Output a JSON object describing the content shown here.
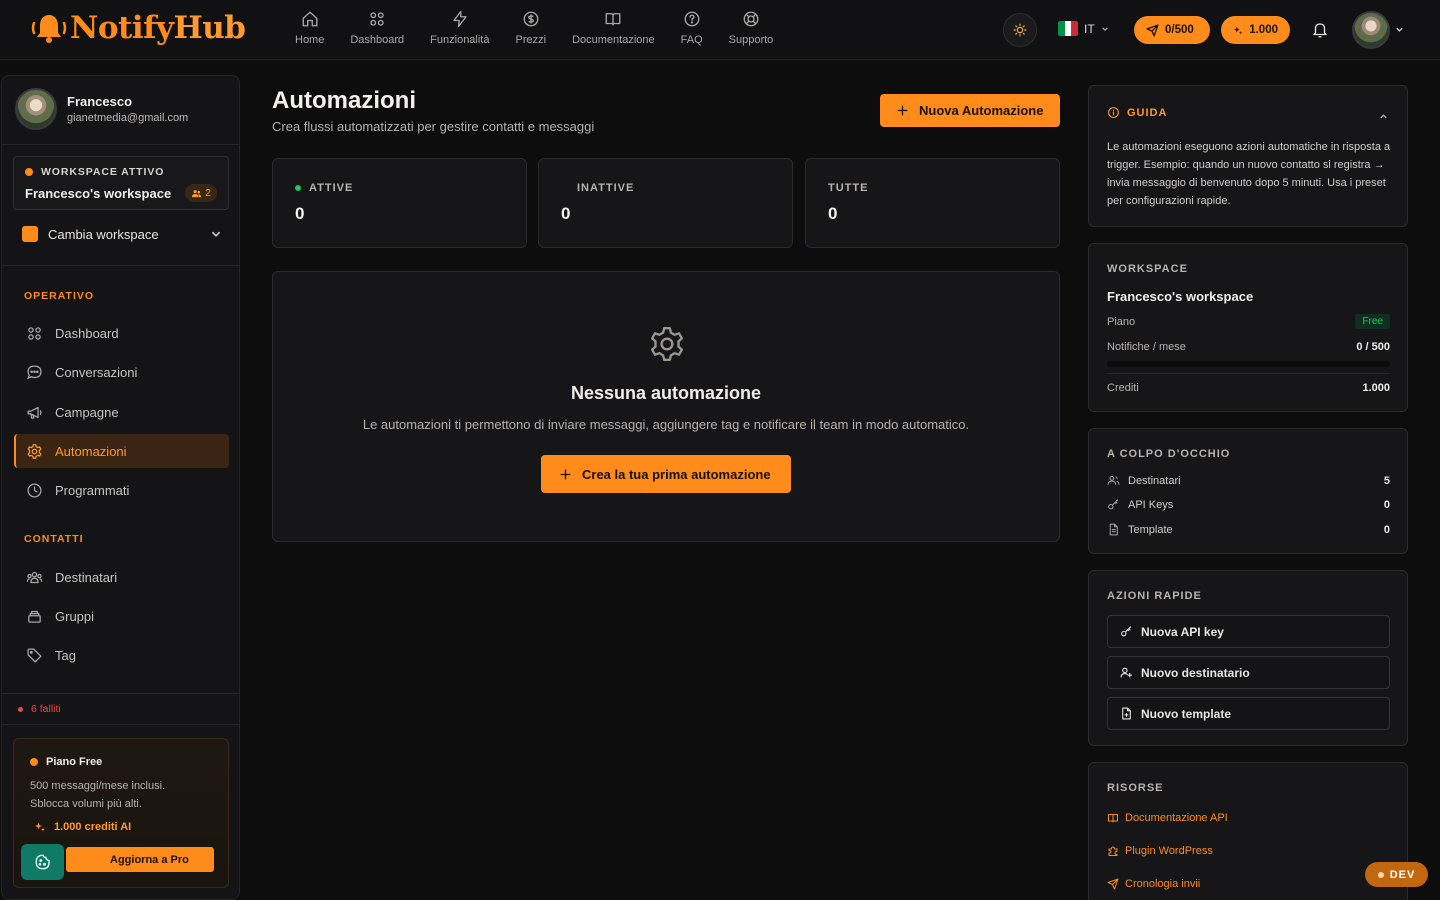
{
  "brand": {
    "name_left": "Notify",
    "name_right": "Hub"
  },
  "nav": [
    {
      "label": "Home",
      "icon": "home-icon"
    },
    {
      "label": "Dashboard",
      "icon": "grid-icon"
    },
    {
      "label": "Funzionalità",
      "icon": "bolt-icon"
    },
    {
      "label": "Prezzi",
      "icon": "dollar-icon"
    },
    {
      "label": "Documentazione",
      "icon": "book-icon"
    },
    {
      "label": "FAQ",
      "icon": "help-circle-icon"
    },
    {
      "label": "Supporto",
      "icon": "lifebuoy-icon"
    }
  ],
  "header": {
    "language": "IT",
    "quota": "0/500",
    "credits": "1.000"
  },
  "user": {
    "name": "Francesco",
    "email": "gianetmedia@gmail.com"
  },
  "workspace": {
    "active_label": "WORKSPACE ATTIVO",
    "name": "Francesco's workspace",
    "members": "2",
    "switch_label": "Cambia workspace"
  },
  "sidebar": {
    "section_operativo": "OPERATIVO",
    "operativo": [
      {
        "label": "Dashboard",
        "icon": "grid-icon"
      },
      {
        "label": "Conversazioni",
        "icon": "chat-icon"
      },
      {
        "label": "Campagne",
        "icon": "megaphone-icon"
      },
      {
        "label": "Automazioni",
        "icon": "gear-icon"
      },
      {
        "label": "Programmati",
        "icon": "clock-icon"
      }
    ],
    "section_contatti": "CONTATTI",
    "contatti": [
      {
        "label": "Destinatari",
        "icon": "users-icon"
      },
      {
        "label": "Gruppi",
        "icon": "stack-icon"
      },
      {
        "label": "Tag",
        "icon": "tag-icon"
      }
    ],
    "failed": "6 falliti"
  },
  "plan": {
    "title": "Piano Free",
    "desc_line1": "500 messaggi/mese inclusi.",
    "desc_line2": "Sblocca volumi più alti.",
    "credits": "1.000 crediti AI",
    "upgrade": "Aggiorna a Pro"
  },
  "main": {
    "title": "Automazioni",
    "subtitle": "Crea flussi automatizzati per gestire contatti e messaggi",
    "new_button": "Nuova Automazione",
    "stats": [
      {
        "label": "ATTIVE",
        "value": "0"
      },
      {
        "label": "INATTIVE",
        "value": "0"
      },
      {
        "label": "TUTTE",
        "value": "0"
      }
    ],
    "empty": {
      "title": "Nessuna automazione",
      "desc": "Le automazioni ti permettono di inviare messaggi, aggiungere tag e notificare il team in modo automatico.",
      "button": "Crea la tua prima automazione"
    }
  },
  "guide": {
    "title": "GUIDA",
    "text": "Le automazioni eseguono azioni automatiche in risposta a trigger. Esempio: quando un nuovo contatto si registra → invia messaggio di benvenuto dopo 5 minuti. Usa i preset per configurazioni rapide."
  },
  "ws_card": {
    "title": "WORKSPACE",
    "name": "Francesco's workspace",
    "plan_label": "Piano",
    "plan_value": "Free",
    "notif_label": "Notifiche / mese",
    "notif_value": "0 / 500",
    "notif_fraction": 0,
    "credits_label": "Crediti",
    "credits_value": "1.000"
  },
  "glance": {
    "title": "A COLPO D'OCCHIO",
    "rows": [
      {
        "label": "Destinatari",
        "value": "5",
        "icon": "users-icon"
      },
      {
        "label": "API Keys",
        "value": "0",
        "icon": "key-icon"
      },
      {
        "label": "Template",
        "value": "0",
        "icon": "file-icon"
      }
    ]
  },
  "quick": {
    "title": "AZIONI RAPIDE",
    "buttons": [
      {
        "label": "Nuova API key",
        "icon": "key-icon"
      },
      {
        "label": "Nuovo destinatario",
        "icon": "user-plus-icon"
      },
      {
        "label": "Nuovo template",
        "icon": "file-plus-icon"
      }
    ]
  },
  "resources": {
    "title": "RISORSE",
    "links": [
      {
        "label": "Documentazione API",
        "icon": "book-icon"
      },
      {
        "label": "Plugin WordPress",
        "icon": "puzzle-icon"
      },
      {
        "label": "Cronologia invii",
        "icon": "send-icon"
      }
    ]
  },
  "dev": "DEV",
  "colors": {
    "accent": "#ff8c1a",
    "background": "#0d0d0e",
    "card": "#161618",
    "success": "#22c55e",
    "danger": "#ef4444"
  }
}
